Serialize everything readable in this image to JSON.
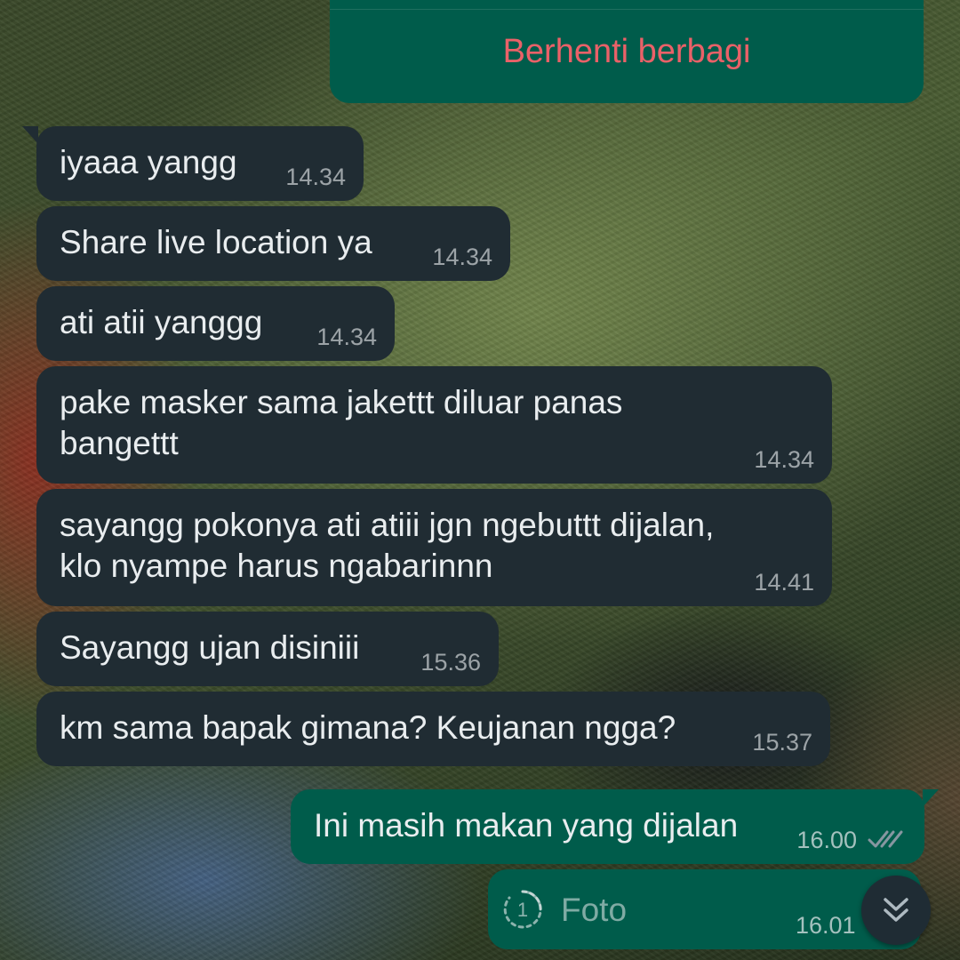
{
  "live_location": {
    "stop_label": "Berhenti berbagi"
  },
  "messages": [
    {
      "direction": "incoming",
      "text": "iyaaa yangg",
      "time": "14.34"
    },
    {
      "direction": "incoming",
      "text": "Share live location ya",
      "time": "14.34"
    },
    {
      "direction": "incoming",
      "text": "ati atii yanggg",
      "time": "14.34"
    },
    {
      "direction": "incoming",
      "text": "pake masker sama jakettt diluar panas\nbangettt",
      "time": "14.34"
    },
    {
      "direction": "incoming",
      "text": "sayangg pokonya ati atiii jgn ngebuttt dijalan,\nklo nyampe harus ngabarinnn",
      "time": "14.41"
    },
    {
      "direction": "incoming",
      "text": "Sayangg ujan disiniii",
      "time": "15.36"
    },
    {
      "direction": "incoming",
      "text": "km sama bapak gimana? Keujanan ngga?",
      "time": "15.37"
    },
    {
      "direction": "outgoing",
      "text": "Ini masih makan yang dijalan",
      "time": "16.00",
      "status": "read-ticks"
    }
  ],
  "photo_message": {
    "label": "Foto",
    "time": "16.01",
    "icon": "view-once-icon"
  },
  "scroll_button": {
    "icon": "double-chevron-down-icon"
  },
  "colors": {
    "incoming_bubble": "#202c33",
    "outgoing_bubble": "#005c4b",
    "stop_text": "#ea6168",
    "ticks": "#8696a0"
  }
}
